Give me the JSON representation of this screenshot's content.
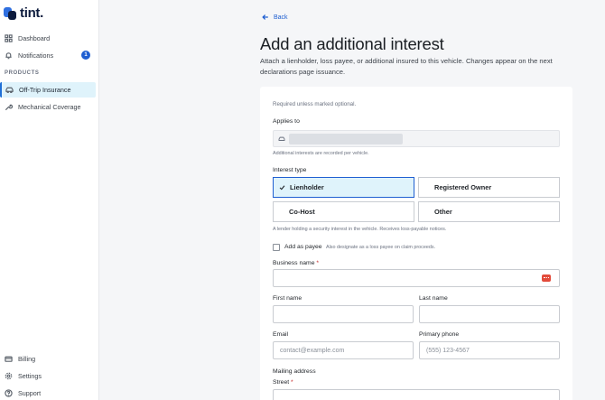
{
  "app": {
    "name": "tint."
  },
  "sidebar": {
    "items": [
      {
        "label": "Dashboard"
      },
      {
        "label": "Notifications",
        "badge": "1"
      },
      {
        "label": "Off-Trip Insurance"
      },
      {
        "label": "Mechanical Coverage"
      }
    ],
    "section_label": "PRODUCTS",
    "bottom_items": [
      {
        "label": "Billing"
      },
      {
        "label": "Settings"
      },
      {
        "label": "Support"
      }
    ]
  },
  "header": {
    "back_label": "Back",
    "title": "Add an additional interest",
    "description": "Attach a lienholder, loss payee, or additional insured to this vehicle. Changes appear on the next declarations page issuance."
  },
  "form": {
    "required_note": "Required unless marked optional.",
    "applies_to": {
      "label": "Applies to",
      "hint": "Additional interests are recorded per vehicle."
    },
    "interest_type": {
      "label": "Interest type",
      "options": [
        "Lienholder",
        "Registered Owner",
        "Co-Host",
        "Other"
      ],
      "selected": "Lienholder",
      "hint": "A lender holding a security interest in the vehicle. Receives loss-payable notices."
    },
    "payee": {
      "label": "Add as payee",
      "hint": "Also designate as a loss payee on claim proceeds.",
      "checked": false
    },
    "business_name": {
      "label": "Business name",
      "required_mark": "*",
      "value": ""
    },
    "first_name": {
      "label": "First name",
      "value": ""
    },
    "last_name": {
      "label": "Last name",
      "value": ""
    },
    "email": {
      "label": "Email",
      "placeholder": "contact@example.com"
    },
    "phone": {
      "label": "Primary phone",
      "placeholder": "(555) 123-4567"
    },
    "mailing_address": {
      "label": "Mailing address"
    },
    "street": {
      "label": "Street",
      "required_mark": "*"
    }
  },
  "colors": {
    "accent": "#1f5fd1",
    "selected_bg": "#dff3fb",
    "required": "#c62828"
  }
}
